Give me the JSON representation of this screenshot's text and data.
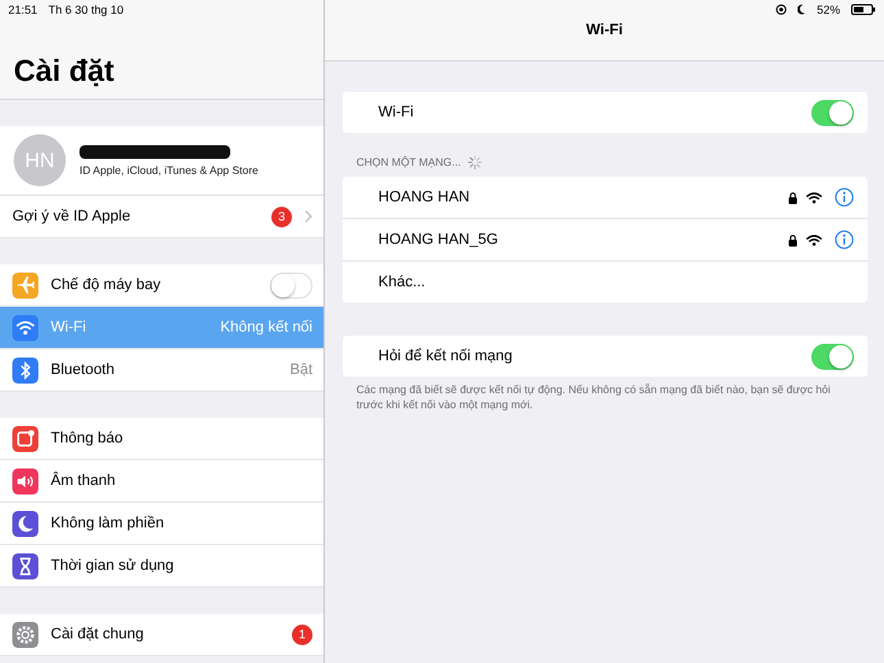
{
  "status_bar": {
    "time": "21:51",
    "date": "Th 6 30 thg 10",
    "battery": "52%"
  },
  "sidebar": {
    "title": "Cài đặt",
    "profile": {
      "initials": "HN",
      "name_redacted": true,
      "subtitle": "ID Apple, iCloud, iTunes & App Store"
    },
    "groups": [
      [
        {
          "kind": "link",
          "label": "Gợi ý về ID Apple",
          "badge": "3",
          "selected": false
        }
      ],
      [
        {
          "kind": "toggle",
          "color": "#f5a623",
          "label": "Chế độ máy bay",
          "on": false,
          "selected": false
        },
        {
          "kind": "value",
          "color": "#2f7cf6",
          "label": "Wi-Fi",
          "value": "Không kết nối",
          "selected": true
        },
        {
          "kind": "value",
          "color": "#2f7cf6",
          "label": "Bluetooth",
          "value": "Bật",
          "selected": false
        }
      ],
      [
        {
          "kind": "plain",
          "color": "#ee4038",
          "label": "Thông báo",
          "selected": false
        },
        {
          "kind": "plain",
          "color": "#f0365c",
          "label": "Âm thanh",
          "selected": false
        },
        {
          "kind": "plain",
          "color": "#5b50d6",
          "label": "Không làm phiền",
          "selected": false
        },
        {
          "kind": "plain",
          "color": "#5b50d6",
          "label": "Thời gian sử dụng",
          "selected": false
        }
      ],
      [
        {
          "kind": "plain",
          "color": "#8e8e93",
          "label": "Cài đặt chung",
          "badge": "1",
          "selected": false
        }
      ]
    ]
  },
  "detail": {
    "title": "Wi-Fi",
    "wifi_toggle": {
      "label": "Wi-Fi",
      "on": true
    },
    "section_header": "CHỌN MỘT MẠNG...",
    "scanning": true,
    "networks": [
      {
        "kind": "network",
        "name": "HOANG HAN",
        "locked": true
      },
      {
        "kind": "network",
        "name": "HOANG HAN_5G",
        "locked": true
      },
      {
        "kind": "other",
        "name": "Khác..."
      }
    ],
    "ask_toggle": {
      "label": "Hỏi để kết nối mạng",
      "on": true
    },
    "footer": "Các mạng đã biết sẽ được kết nối tự động. Nếu không có sẵn mạng đã biết nào, bạn sẽ được hỏi trước khi kết nối vào một mạng mới."
  }
}
